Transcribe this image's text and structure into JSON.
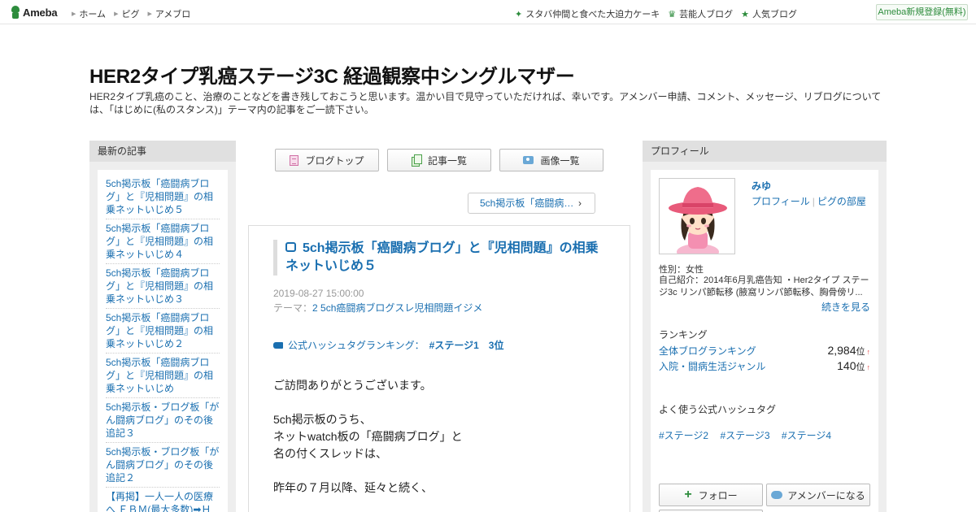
{
  "topbar": {
    "logo_text": "Ameba",
    "nav": [
      "ホーム",
      "ピグ",
      "アメブロ"
    ],
    "right_links": [
      {
        "icon": "sparkle-icon",
        "label": "スタバ仲間と食べた大迫力ケーキ"
      },
      {
        "icon": "crown-icon",
        "label": "芸能人ブログ"
      },
      {
        "icon": "star-icon",
        "label": "人気ブログ"
      }
    ],
    "register_label": "Ameba新規登録(無料)"
  },
  "header": {
    "title": "HER2タイプ乳癌ステージ3C 経過観察中シングルマザー",
    "description": "HER2タイプ乳癌のこと、治療のことなどを書き残しておこうと思います。温かい目で見守っていただければ、幸いです。アメンバー申請、コメント、メッセージ、リブログについては、「はじめに(私のスタンス)」テーマ内の記事をご一読下さい。"
  },
  "left_sidebar": {
    "heading": "最新の記事",
    "entries": [
      "5ch掲示板「癌闘病ブログ」と『児相問題』の相乗ネットいじめ５",
      "5ch掲示板「癌闘病ブログ」と『児相問題』の相乗ネットいじめ４",
      "5ch掲示板「癌闘病ブログ」と『児相問題』の相乗ネットいじめ３",
      "5ch掲示板「癌闘病ブログ」と『児相問題』の相乗ネットいじめ２",
      "5ch掲示板「癌闘病ブログ」と『児相問題』の相乗ネットいじめ",
      "5ch掲示板・ブログ板「がん闘病ブログ」のその後 追記３",
      "5ch掲示板・ブログ板「がん闘病ブログ」のその後 追記２",
      "【再掲】一人一人の医療へ ＥＢＭ(最大多数)➡Ｈ"
    ]
  },
  "center": {
    "buttons": [
      {
        "icon": "blog-top-icon",
        "label": "ブログトップ"
      },
      {
        "icon": "article-list-icon",
        "label": "記事一覧"
      },
      {
        "icon": "camera-icon",
        "label": "画像一覧"
      }
    ],
    "next_link": "5ch掲示板「癌闘病…",
    "article": {
      "title": "5ch掲示板「癌闘病ブログ」と『児相問題』の相乗ネットいじめ５",
      "date": "2019-08-27 15:00:00",
      "theme_label": "テーマ：",
      "theme": "2 5ch癌闘病ブログスレ児相問題イジメ",
      "hashtag_label": "公式ハッシュタグランキング：",
      "hashtag_rank": "#ステージ1　3位",
      "body": [
        "ご訪問ありがとうございます。",
        "5ch掲示板のうち、",
        "ネットwatch板の「癌闘病ブログ」と",
        "名の付くスレッドは、",
        "昨年の７月以降、延々と続く、"
      ]
    }
  },
  "right_sidebar": {
    "heading": "プロフィール",
    "name": "みゆ",
    "link_profile": "プロフィール",
    "link_room": "ピグの部屋",
    "gender": "性別：女性",
    "intro": "自己紹介：2014年6月乳癌告知 ・Her2タイプ ステージ3c リンパ節転移 (腋窩リンパ節転移、胸骨傍リ...",
    "more": "続きを見る",
    "ranking_heading": "ランキング",
    "rankings": [
      {
        "label": "全体ブログランキング",
        "value": "2,984",
        "unit": "位",
        "trend": "↑"
      },
      {
        "label": "入院・闘病生活ジャンル",
        "value": "140",
        "unit": "位",
        "trend": "↑"
      }
    ],
    "hashtag_heading": "よく使う公式ハッシュタグ",
    "hashtags": [
      "#ステージ2",
      "#ステージ3",
      "#ステージ4"
    ],
    "follow_label": "フォロー",
    "amember_label": "アメンバーになる"
  }
}
